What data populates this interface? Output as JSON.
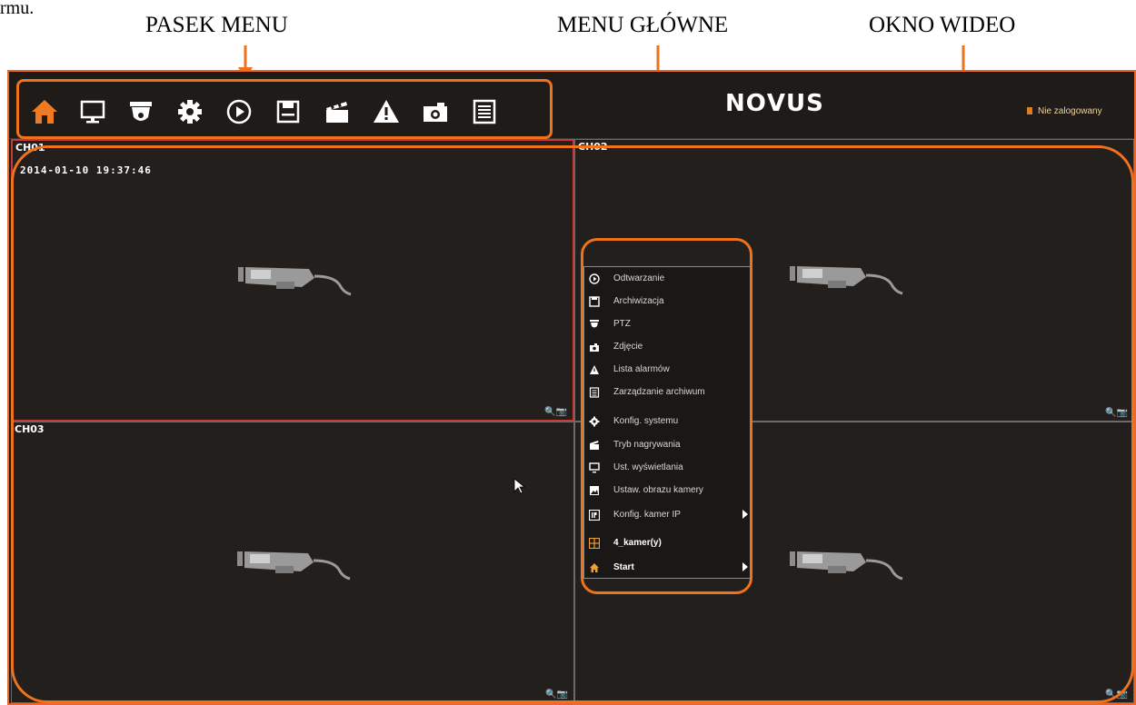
{
  "corner_text": "rmu.",
  "callouts": {
    "menu_bar": "PASEK MENU",
    "main_menu": "MENU GŁÓWNE",
    "video_window": "OKNO WIDEO"
  },
  "header": {
    "logo_left": "NO",
    "logo_right": "US",
    "user_status": "Nie zalogowany"
  },
  "toolbar_icons": [
    "home-icon",
    "monitor-icon",
    "ptz-camera-icon",
    "gear-icon",
    "play-icon",
    "floppy-disk-icon",
    "clapperboard-icon",
    "warning-icon",
    "camera-icon",
    "list-icon"
  ],
  "channels": {
    "ch01": "CH01",
    "ch02": "CH02",
    "ch03": "CH03",
    "timestamp": "2014-01-10 19:37:46"
  },
  "context_menu": {
    "items": [
      {
        "label": "Odtwarzanie",
        "icon": "play-icon"
      },
      {
        "label": "Archiwizacja",
        "icon": "floppy-disk-icon"
      },
      {
        "label": "PTZ",
        "icon": "ptz-camera-icon"
      },
      {
        "label": "Zdjęcie",
        "icon": "camera-icon"
      },
      {
        "label": "Lista alarmów",
        "icon": "warning-icon"
      },
      {
        "label": "Zarządzanie archiwum",
        "icon": "list-icon"
      },
      {
        "label": "Konfig. systemu",
        "icon": "gear-icon"
      },
      {
        "label": "Tryb nagrywania",
        "icon": "clapperboard-icon"
      },
      {
        "label": "Ust. wyświetlania",
        "icon": "monitor-icon"
      },
      {
        "label": "Ustaw. obrazu kamery",
        "icon": "image-icon"
      },
      {
        "label": "Konfig. kamer IP",
        "icon": "ip-icon"
      },
      {
        "label": "4_kamer(y)",
        "icon": "grid-icon"
      },
      {
        "label": "Start",
        "icon": "home-icon"
      }
    ]
  },
  "colors": {
    "accent_orange": "#f0721d",
    "dvr_background": "#1f1c1a",
    "selected_tile_border": "#c83a3a"
  }
}
